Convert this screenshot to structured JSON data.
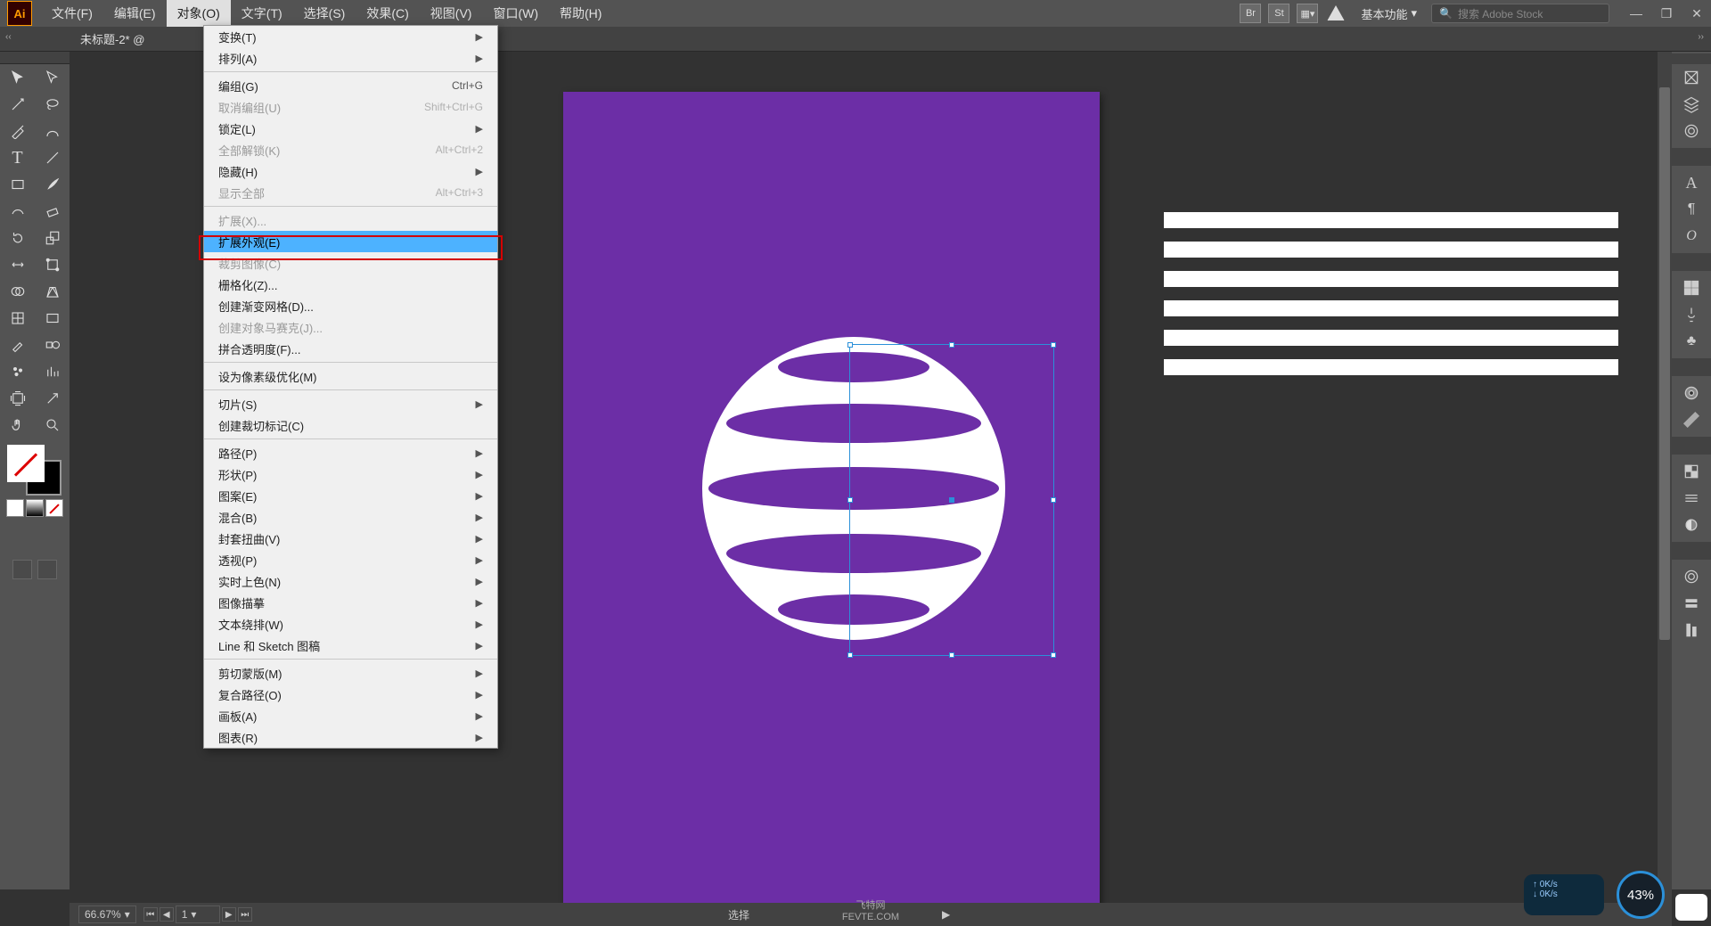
{
  "app": {
    "icon_text": "Ai"
  },
  "menu": {
    "items": [
      "文件(F)",
      "编辑(E)",
      "对象(O)",
      "文字(T)",
      "选择(S)",
      "效果(C)",
      "视图(V)",
      "窗口(W)",
      "帮助(H)"
    ],
    "active_index": 2
  },
  "menubar_right": {
    "br": "Br",
    "st": "St",
    "workspace": "基本功能",
    "search_placeholder": "搜索 Adobe Stock"
  },
  "doc_tab": "未标题-2* @",
  "object_menu": {
    "groups": [
      [
        {
          "label": "变换(T)",
          "arrow": true
        },
        {
          "label": "排列(A)",
          "arrow": true
        }
      ],
      [
        {
          "label": "编组(G)",
          "shortcut": "Ctrl+G"
        },
        {
          "label": "取消编组(U)",
          "shortcut": "Shift+Ctrl+G",
          "disabled": true
        },
        {
          "label": "锁定(L)",
          "arrow": true
        },
        {
          "label": "全部解锁(K)",
          "shortcut": "Alt+Ctrl+2",
          "disabled": true
        },
        {
          "label": "隐藏(H)",
          "arrow": true
        },
        {
          "label": "显示全部",
          "shortcut": "Alt+Ctrl+3",
          "disabled": true
        }
      ],
      [
        {
          "label": "扩展(X)...",
          "disabled": true
        },
        {
          "label": "扩展外观(E)",
          "highlight": true
        },
        {
          "label": "裁剪图像(C)",
          "disabled": true
        },
        {
          "label": "栅格化(Z)..."
        },
        {
          "label": "创建渐变网格(D)..."
        },
        {
          "label": "创建对象马赛克(J)...",
          "disabled": true
        },
        {
          "label": "拼合透明度(F)..."
        }
      ],
      [
        {
          "label": "设为像素级优化(M)"
        }
      ],
      [
        {
          "label": "切片(S)",
          "arrow": true
        },
        {
          "label": "创建裁切标记(C)"
        }
      ],
      [
        {
          "label": "路径(P)",
          "arrow": true
        },
        {
          "label": "形状(P)",
          "arrow": true
        },
        {
          "label": "图案(E)",
          "arrow": true
        },
        {
          "label": "混合(B)",
          "arrow": true
        },
        {
          "label": "封套扭曲(V)",
          "arrow": true
        },
        {
          "label": "透视(P)",
          "arrow": true
        },
        {
          "label": "实时上色(N)",
          "arrow": true
        },
        {
          "label": "图像描摹",
          "arrow": true
        },
        {
          "label": "文本绕排(W)",
          "arrow": true
        },
        {
          "label": "Line 和 Sketch 图稿",
          "arrow": true
        }
      ],
      [
        {
          "label": "剪切蒙版(M)",
          "arrow": true
        },
        {
          "label": "复合路径(O)",
          "arrow": true
        },
        {
          "label": "画板(A)",
          "arrow": true
        },
        {
          "label": "图表(R)",
          "arrow": true
        }
      ]
    ]
  },
  "statusbar": {
    "zoom": "66.67%",
    "artboard_num": "1",
    "mode": "选择",
    "site1": "飞特网",
    "site2": "FEVTE.COM"
  },
  "net": {
    "up": "0K/s",
    "down": "0K/s"
  },
  "pct": "43%"
}
